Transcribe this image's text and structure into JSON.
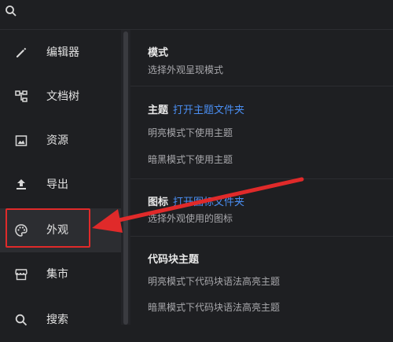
{
  "sidebar": {
    "items": [
      {
        "label": "编辑器",
        "icon": "pencil-icon"
      },
      {
        "label": "文档树",
        "icon": "tree-icon"
      },
      {
        "label": "资源",
        "icon": "image-icon"
      },
      {
        "label": "导出",
        "icon": "upload-icon"
      },
      {
        "label": "外观",
        "icon": "palette-icon"
      },
      {
        "label": "集市",
        "icon": "store-icon"
      },
      {
        "label": "搜索",
        "icon": "search-icon"
      }
    ]
  },
  "content": {
    "mode": {
      "title": "模式",
      "desc": "选择外观呈现模式"
    },
    "theme": {
      "title": "主题",
      "link": "打开主题文件夹",
      "light": "明亮模式下使用主题",
      "dark": "暗黑模式下使用主题"
    },
    "icon": {
      "title": "图标",
      "link": "打开图标文件夹",
      "desc": "选择外观使用的图标"
    },
    "codeblock": {
      "title": "代码块主题",
      "light": "明亮模式下代码块语法高亮主题",
      "dark": "暗黑模式下代码块语法高亮主题"
    }
  },
  "colors": {
    "highlight": "#e02a2a",
    "link": "#4a8ef2",
    "background": "#1e1f22"
  }
}
